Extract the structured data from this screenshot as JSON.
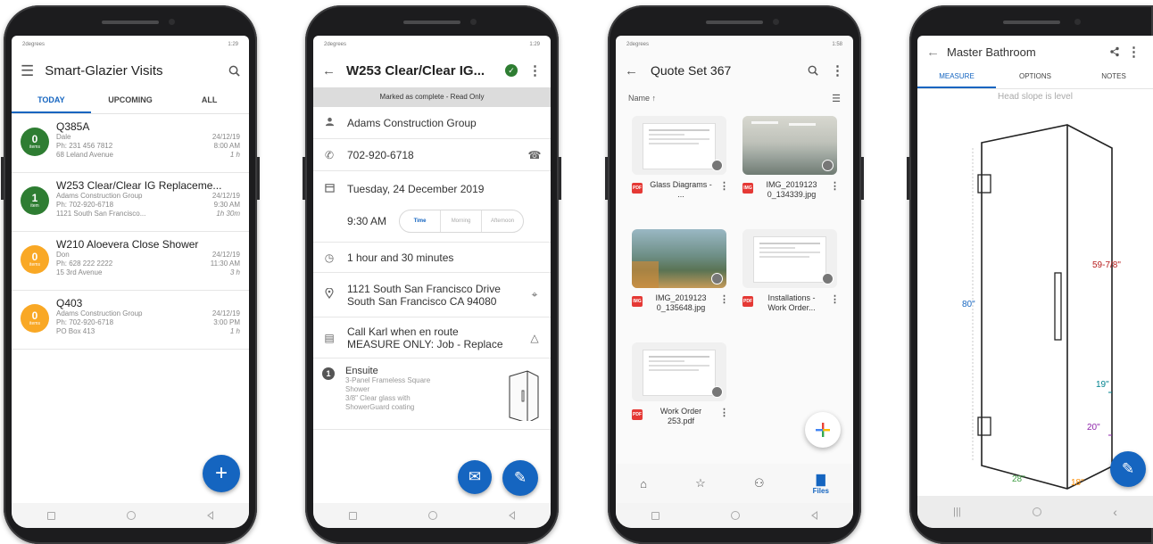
{
  "phone1": {
    "status_left": "2degrees",
    "status_right": "1:29",
    "title": "Smart-Glazier Visits",
    "tabs": [
      "TODAY",
      "UPCOMING",
      "ALL"
    ],
    "visits": [
      {
        "count": "0",
        "unit": "items",
        "color": "#2e7d32",
        "title": "Q385A",
        "name": "Dale",
        "phone": "Ph: 231 456 7812",
        "address": "68 Leland Avenue",
        "date": "24/12/19",
        "time": "8:00 AM",
        "duration": "1 h"
      },
      {
        "count": "1",
        "unit": "item",
        "color": "#2e7d32",
        "title": "W253 Clear/Clear IG Replaceme...",
        "name": "Adams Construction Group",
        "phone": "Ph: 702-920-6718",
        "address": "1121 South San Francisco...",
        "date": "24/12/19",
        "time": "9:30 AM",
        "duration": "1h 30m"
      },
      {
        "count": "0",
        "unit": "items",
        "color": "#f9a825",
        "title": "W210 Aloevera Close Shower",
        "name": "Don",
        "phone": "Ph: 628 222 2222",
        "address": "15 3rd Avenue",
        "date": "24/12/19",
        "time": "11:30 AM",
        "duration": "3 h"
      },
      {
        "count": "0",
        "unit": "items",
        "color": "#f9a825",
        "title": "Q403",
        "name": "Adams Construction Group",
        "phone": "Ph: 702-920-6718",
        "address": "PO Box 413",
        "date": "24/12/19",
        "time": "3:00 PM",
        "duration": "1 h"
      }
    ],
    "fab": "+"
  },
  "phone2": {
    "status_left": "2degrees",
    "status_right": "1:29",
    "title": "W253 Clear/Clear IG...",
    "banner": "Marked as complete - Read Only",
    "company": "Adams Construction Group",
    "phone": "702-920-6718",
    "date": "Tuesday, 24 December 2019",
    "time": "9:30 AM",
    "segments": [
      "Time",
      "Morning",
      "Afternoon"
    ],
    "duration": "1 hour and 30 minutes",
    "address_line1": "1121 South San Francisco Drive",
    "address_line2": "South San Francisco  CA  94080",
    "note_line1": "Call Karl when en route",
    "note_line2": "MEASURE ONLY: Job - Replace",
    "item_number": "1",
    "item_title": "Ensuite",
    "item_desc1": "3-Panel Frameless Square",
    "item_desc2": "Shower",
    "item_desc3": "3/8\" Clear glass with",
    "item_desc4": "ShowerGuard coating"
  },
  "phone3": {
    "status_left": "2degrees",
    "status_right": "1:58",
    "title": "Quote Set 367",
    "sort_label": "Name ↑",
    "files": [
      {
        "name": "Glass Diagrams - ...",
        "type": "PDF",
        "thumb": "doc"
      },
      {
        "name": "IMG_2019123 0_134339.jpg",
        "type": "IMG",
        "thumb": "photo-office"
      },
      {
        "name": "IMG_2019123 0_135648.jpg",
        "type": "IMG",
        "thumb": "photo-outdoor"
      },
      {
        "name": "Installations - Work Order...",
        "type": "PDF",
        "thumb": "doc"
      },
      {
        "name": "Work Order 253.pdf",
        "type": "PDF",
        "thumb": "doc"
      }
    ],
    "nav": [
      {
        "icon": "home-icon",
        "label": ""
      },
      {
        "icon": "star-icon",
        "label": ""
      },
      {
        "icon": "people-icon",
        "label": ""
      },
      {
        "icon": "folder-icon",
        "label": "Files"
      }
    ]
  },
  "phone4": {
    "title": "Master Bathroom",
    "tabs": [
      "MEASURE",
      "OPTIONS",
      "NOTES"
    ],
    "head_note": "Head slope is level",
    "dims": [
      {
        "label": "80\"",
        "color": "#1565c0"
      },
      {
        "label": "59-7/8\"",
        "color": "#b71c1c"
      },
      {
        "label": "19\"",
        "color": "#00838f"
      },
      {
        "label": "20\"",
        "color": "#8e24aa"
      },
      {
        "label": "28\"",
        "color": "#43a047"
      },
      {
        "label": "18\"",
        "color": "#fb8c00"
      }
    ]
  }
}
